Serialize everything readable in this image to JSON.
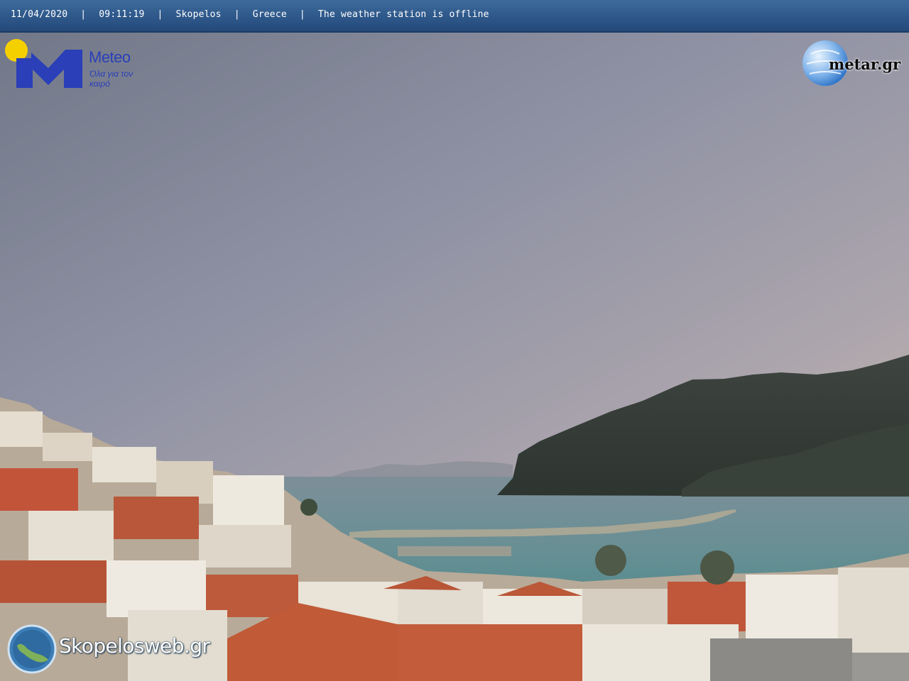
{
  "overlay": {
    "date": "11/04/2020",
    "time": "09:11:19",
    "location": "Skopelos",
    "country": "Greece",
    "status": "The weather station is offline",
    "separator": "|"
  },
  "logos": {
    "meteo_name": "Meteo",
    "meteo_tagline": "Όλα για τον καιρό",
    "metar": "metar.gr",
    "skopelos": "Skopelosweb.gr"
  },
  "colors": {
    "bar": "#2d5688",
    "meteo_blue": "#2a3fb8",
    "sun": "#f5d000"
  }
}
